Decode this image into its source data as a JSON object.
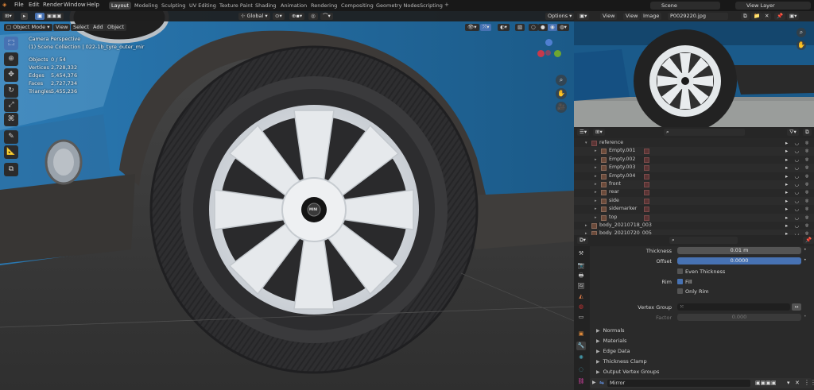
{
  "menu": [
    "File",
    "Edit",
    "Render",
    "Window",
    "Help"
  ],
  "workspaces": [
    "Layout",
    "Modeling",
    "Sculpting",
    "UV Editing",
    "Texture Paint",
    "Shading",
    "Animation",
    "Rendering",
    "Compositing",
    "Geometry Nodes",
    "Scripting"
  ],
  "active_workspace": "Layout",
  "scene_name": "Scene",
  "view_layer": "View Layer",
  "viewport": {
    "mode": "Object Mode",
    "menus": [
      "View",
      "Select",
      "Add",
      "Object"
    ],
    "orientation": "Global",
    "options_label": "Options",
    "info_title": "Camera Perspective",
    "info_collection": "(1) Scene Collection | 022-1b_tyre_outer_mir",
    "stats": [
      {
        "label": "Objects",
        "value": "0 / 54"
      },
      {
        "label": "Vertices",
        "value": "2,728,332"
      },
      {
        "label": "Edges",
        "value": "5,454,376"
      },
      {
        "label": "Faces",
        "value": "2,727,734"
      },
      {
        "label": "Triangles",
        "value": "5,455,236"
      }
    ],
    "hub_logo": "MINI"
  },
  "image_editor": {
    "menus": [
      "View",
      "View",
      "Image"
    ],
    "image_name": "P0029220.jpg"
  },
  "outliner": {
    "rows": [
      {
        "name": "reference",
        "indent": 1,
        "icon": "collection"
      },
      {
        "name": "Empty.001",
        "indent": 2,
        "icon": "empty",
        "mod": true
      },
      {
        "name": "Empty.002",
        "indent": 2,
        "icon": "empty",
        "mod": true
      },
      {
        "name": "Empty.003",
        "indent": 2,
        "icon": "empty",
        "mod": true
      },
      {
        "name": "Empty.004",
        "indent": 2,
        "icon": "empty",
        "mod": true
      },
      {
        "name": "front",
        "indent": 2,
        "icon": "empty",
        "mod": true
      },
      {
        "name": "rear",
        "indent": 2,
        "icon": "empty",
        "mod": true
      },
      {
        "name": "side",
        "indent": 2,
        "icon": "empty",
        "mod": true
      },
      {
        "name": "sidemarker",
        "indent": 2,
        "icon": "empty",
        "mod": true
      },
      {
        "name": "top",
        "indent": 2,
        "icon": "empty",
        "mod": true
      },
      {
        "name": "body_20210718_003",
        "indent": 1,
        "icon": "mesh"
      },
      {
        "name": "body_20210720_005",
        "indent": 1,
        "icon": "mesh"
      }
    ]
  },
  "properties": {
    "thickness_label": "Thickness",
    "thickness_value": "0.01 m",
    "offset_label": "Offset",
    "offset_value": "0.0000",
    "offset_fraction": 1.0,
    "even_thickness_label": "Even Thickness",
    "rim_label": "Rim",
    "fill_label": "Fill",
    "only_rim_label": "Only Rim",
    "vertex_group_label": "Vertex Group",
    "factor_label": "Factor",
    "factor_value": "0.000",
    "panels": [
      "Normals",
      "Materials",
      "Edge Data",
      "Thickness Clamp",
      "Output Vertex Groups"
    ],
    "next_modifier": "Mirror"
  },
  "colors": {
    "accent": "#4772b3",
    "car_blue": "#1f5f8e",
    "wheel": "#e9ecef",
    "tyre": "#2f2f31"
  }
}
